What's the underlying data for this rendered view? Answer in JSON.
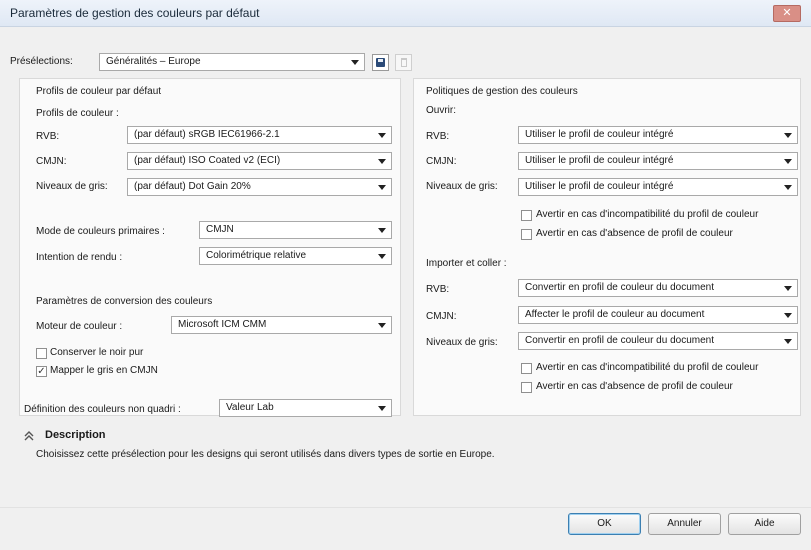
{
  "dialog": {
    "title": "Paramètres de gestion des couleurs par défaut",
    "close_label": "✕"
  },
  "presets": {
    "label": "Présélections:",
    "value": "Généralités – Europe"
  },
  "left": {
    "section_title": "Profils de couleur par défaut",
    "profiles_heading": "Profils de couleur :",
    "rows": [
      {
        "label": "RVB:",
        "value": "(par défaut) sRGB IEC61966-2.1"
      },
      {
        "label": "CMJN:",
        "value": "(par défaut) ISO Coated v2 (ECI)"
      },
      {
        "label": "Niveaux de gris:",
        "value": "(par défaut) Dot Gain 20%"
      }
    ],
    "primary_mode_label": "Mode de couleurs primaires :",
    "primary_mode_value": "CMJN",
    "intent_label": "Intention de rendu :",
    "intent_value": "Colorimétrique relative",
    "conversion_title": "Paramètres de conversion des couleurs",
    "engine_label": "Moteur de couleur :",
    "engine_value": "Microsoft ICM CMM",
    "keep_black_label": "Conserver le noir pur",
    "keep_black_checked": false,
    "map_gray_label": "Mapper le gris en CMJN",
    "map_gray_checked": true,
    "spot_label": "Définition des couleurs non quadri :",
    "spot_value": "Valeur Lab"
  },
  "right": {
    "section_title": "Politiques de gestion des couleurs",
    "open_heading": "Ouvrir:",
    "open_rows": [
      {
        "label": "RVB:",
        "value": "Utiliser le profil de couleur intégré"
      },
      {
        "label": "CMJN:",
        "value": "Utiliser le profil de couleur intégré"
      },
      {
        "label": "Niveaux de gris:",
        "value": "Utiliser le profil de couleur intégré"
      }
    ],
    "open_warn_mismatch": "Avertir en cas d'incompatibilité du profil de couleur",
    "open_warn_missing": "Avertir en cas d'absence de profil de couleur",
    "import_heading": "Importer et coller :",
    "import_rows": [
      {
        "label": "RVB:",
        "value": "Convertir en profil de couleur du document"
      },
      {
        "label": "CMJN:",
        "value": "Affecter le profil de couleur au document"
      },
      {
        "label": "Niveaux de gris:",
        "value": "Convertir en profil de couleur du document"
      }
    ],
    "import_warn_mismatch": "Avertir en cas d'incompatibilité du profil de couleur",
    "import_warn_missing": "Avertir en cas d'absence de profil de couleur"
  },
  "description": {
    "toggle_icon": "double-chevron-up-icon",
    "title": "Description",
    "text": "Choisissez cette présélection pour les designs qui seront utilisés dans divers types de sortie en Europe."
  },
  "buttons": {
    "ok": "OK",
    "cancel": "Annuler",
    "help": "Aide"
  }
}
